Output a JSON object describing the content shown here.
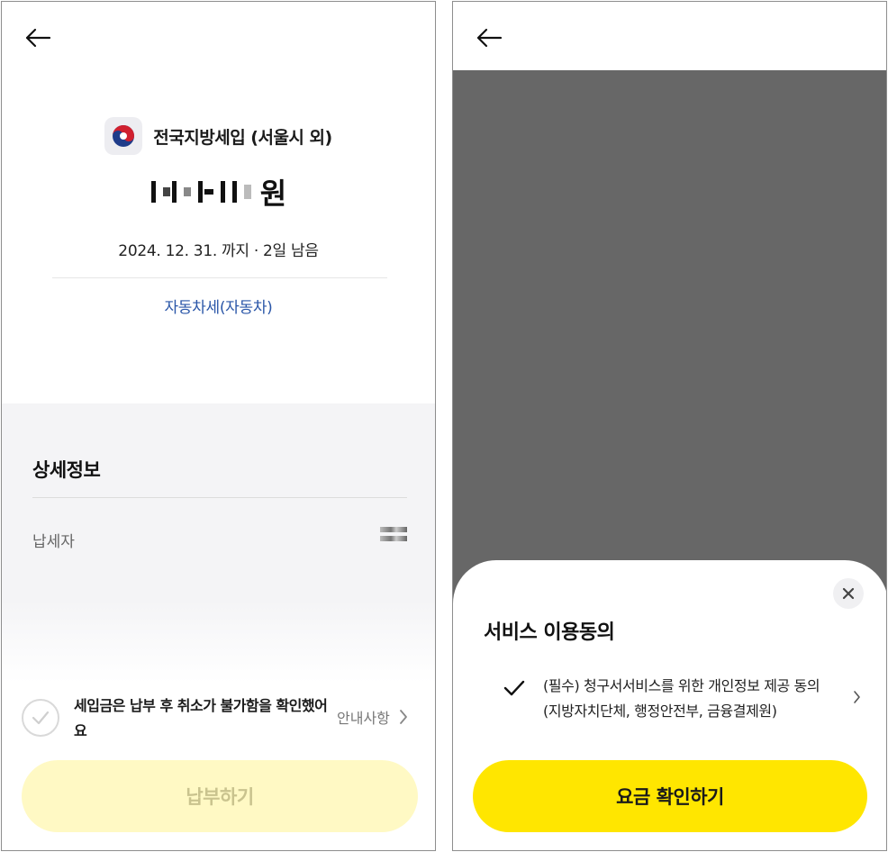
{
  "left": {
    "tax_title": "전국지방세입 (서울시 외)",
    "amount_unit": "원",
    "due_text": "2024. 12. 31. 까지 · 2일 남음",
    "category_link": "자동차세(자동차)",
    "detail": {
      "title": "상세정보",
      "payer_label": "납세자"
    },
    "confirm_text": "세입금은 납부 후 취소가 불가함을 확인했어요",
    "notice_link": "안내사항",
    "pay_button": "납부하기"
  },
  "right": {
    "sheet_title": "서비스 이용동의",
    "agreement_text": "(필수) 청구서서비스를 위한 개인정보 제공 동의 (지방자치단체, 행정안전부, 금융결제원)",
    "fee_button": "요금 확인하기"
  },
  "colors": {
    "primary_yellow": "#ffe600",
    "disabled_yellow": "#fff9c4",
    "link_blue": "#2a56a8",
    "overlay_gray": "#676767"
  },
  "icons": [
    "back-arrow-icon",
    "gov-emblem-icon",
    "checkmark-icon",
    "chevron-right-icon",
    "close-icon"
  ]
}
